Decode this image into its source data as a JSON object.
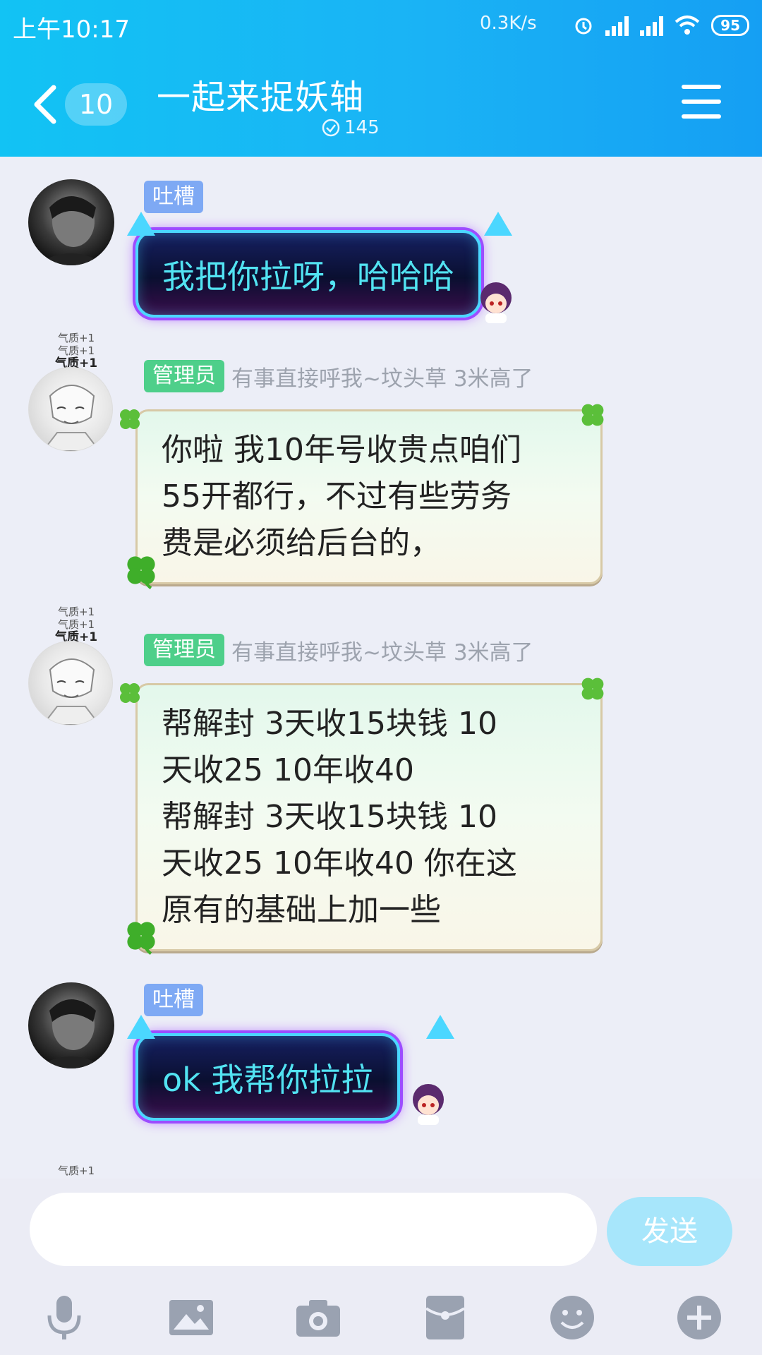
{
  "status_bar": {
    "time": "上午10:17",
    "network_speed": "0.3K/s",
    "battery": "95"
  },
  "header": {
    "back_count": "10",
    "title": "一起来捉妖轴",
    "member_count": "145"
  },
  "messages": [
    {
      "avatar": "dark-boy-avatar",
      "tag": "吐槽",
      "text": "我把你拉呀，哈哈哈"
    },
    {
      "avatar": "manga-boy-avatar",
      "titles": [
        "气质+1",
        "气质+1",
        "气质+1"
      ],
      "tag": "管理员",
      "signature": "有事直接呼我~坟头草 3米高了",
      "lines": [
        "你啦 我10年号收贵点咱们",
        "55开都行，不过有些劳务",
        "费是必须给后台的，"
      ]
    },
    {
      "avatar": "manga-boy-avatar",
      "titles": [
        "气质+1",
        "气质+1",
        "气质+1"
      ],
      "tag": "管理员",
      "signature": "有事直接呼我~坟头草 3米高了",
      "lines": [
        "帮解封   3天收15块钱   10",
        "天收25    10年收40",
        "帮解封   3天收15块钱   10",
        "天收25    10年收40 你在这",
        "原有的基础上加一些"
      ]
    },
    {
      "avatar": "dark-boy-avatar",
      "tag": "吐槽",
      "text": "ok   我帮你拉拉"
    }
  ],
  "partial_title": "气质+1",
  "input": {
    "placeholder": "",
    "send_label": "发送"
  },
  "toolbar": [
    "microphone-icon",
    "image-icon",
    "camera-icon",
    "red-packet-icon",
    "emoji-icon",
    "plus-icon"
  ],
  "colors": {
    "header": "#1ab3f5",
    "tag_blue": "#7ea9f4",
    "tag_green": "#4ecf8a",
    "send_button": "#a7e6fb",
    "dark_bubble_text": "#52e3f2"
  }
}
